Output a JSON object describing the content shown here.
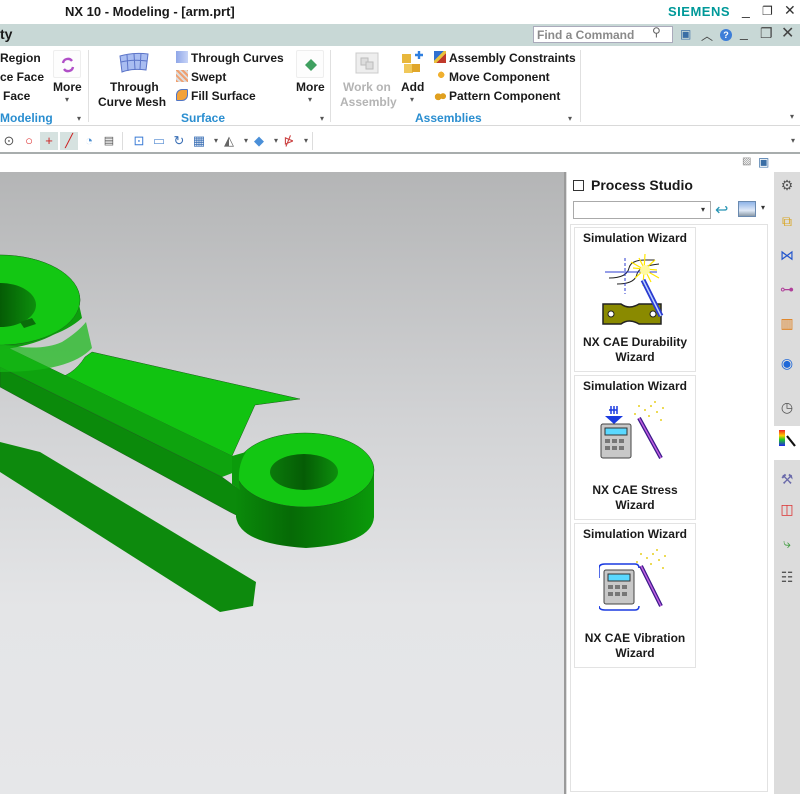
{
  "window": {
    "title": "NX 10 - Modeling - [arm.prt]",
    "brand": "SIEMENS",
    "controls": [
      "_",
      "🗗",
      "✕"
    ]
  },
  "tabstrip": {
    "active_tab_partial": "ty",
    "search": {
      "placeholder": "Find a Command",
      "value": ""
    },
    "controls": [
      "_",
      "🗗",
      "✕"
    ]
  },
  "ribbon": {
    "groups": [
      {
        "name": "Modeling",
        "items": [
          "Region",
          "ce Face",
          "Face"
        ],
        "more_label": "More"
      },
      {
        "name": "Surface",
        "large_button": [
          "Through",
          "Curve Mesh"
        ],
        "items": [
          "Through Curves",
          "Swept",
          "Fill Surface"
        ],
        "more_label": "More"
      },
      {
        "name": "Assemblies",
        "work_on_assembly": [
          "Work on",
          "Assembly"
        ],
        "add_label": "Add",
        "items": [
          "Assembly Constraints",
          "Move Component",
          "Pattern Component"
        ]
      }
    ]
  },
  "panel": {
    "title": "Process Studio",
    "select_value": "",
    "cards": [
      {
        "category": "Simulation Wizard",
        "name_line1": "NX CAE Durability",
        "name_line2": "Wizard",
        "icon": "durability-wizard-icon"
      },
      {
        "category": "Simulation Wizard",
        "name_line1": "NX CAE Stress",
        "name_line2": "Wizard",
        "icon": "stress-wizard-icon"
      },
      {
        "category": "Simulation Wizard",
        "name_line1": "NX CAE Vibration",
        "name_line2": "Wizard",
        "icon": "vibration-wizard-icon"
      }
    ]
  },
  "resource_bar": {
    "items": [
      "settings",
      "assembly-navigator",
      "constraint-navigator",
      "part-navigator",
      "reuse-library",
      "hd3d-tools",
      "history",
      "process-studio",
      "manufacturing-wizards",
      "roles",
      "system-scenes",
      "web-browser"
    ],
    "active": "process-studio"
  },
  "model": {
    "part": "arm.prt",
    "color": "#22c80e"
  }
}
